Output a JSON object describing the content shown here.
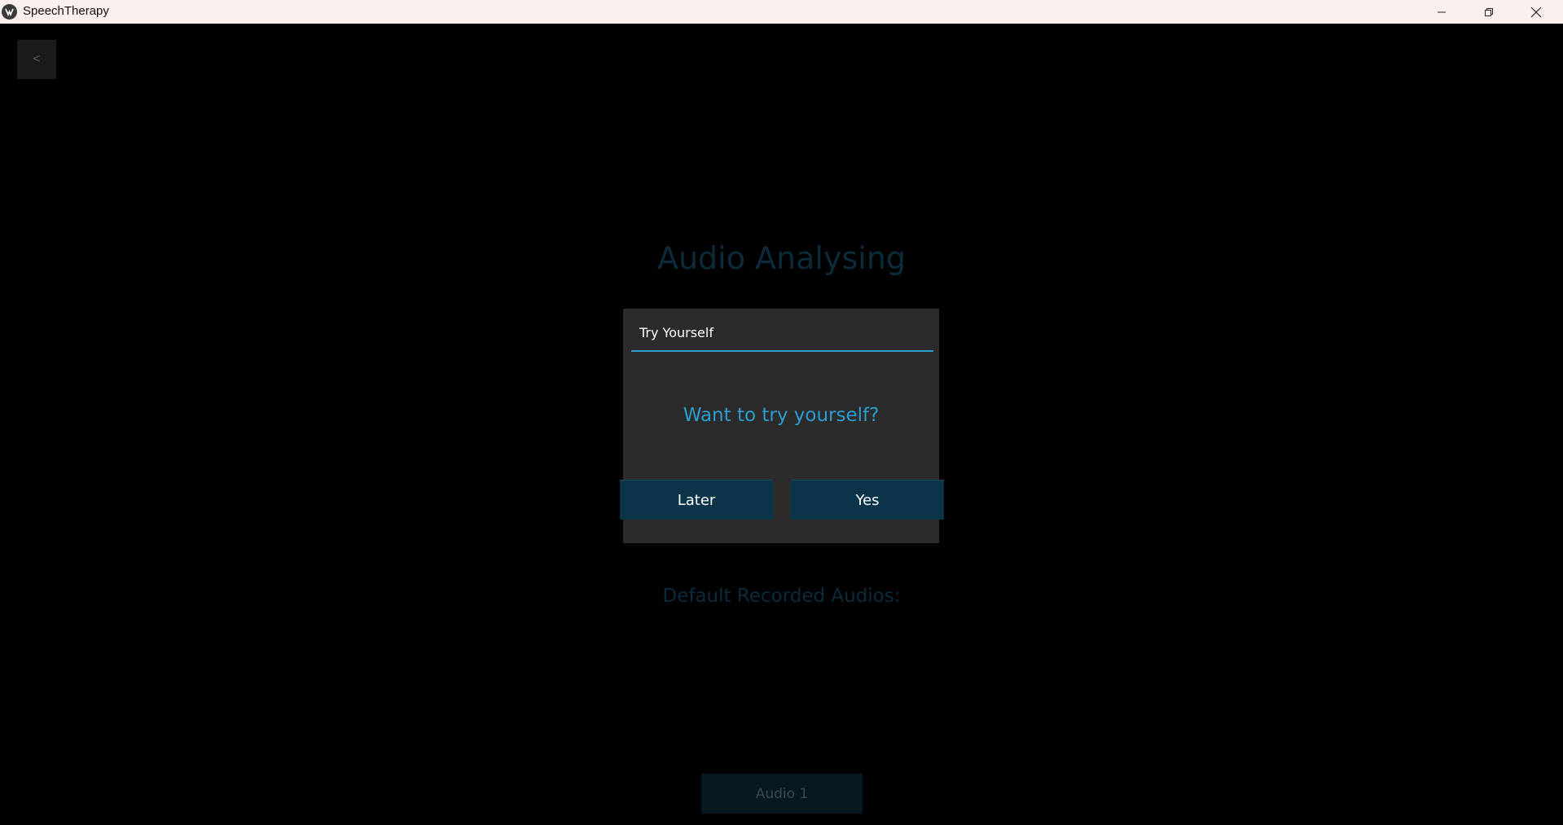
{
  "window": {
    "title": "SpeechTherapy",
    "icon": "app-logo-icon",
    "controls": [
      "minimize-icon",
      "restore-icon",
      "close-icon"
    ]
  },
  "screen": {
    "back_label": "<",
    "title": "Audio Analysing",
    "section_label": "Default Recorded Audios:",
    "audio_items": [
      {
        "label": "Audio 1"
      }
    ]
  },
  "dialog": {
    "title": "Try Yourself",
    "message": "Want to try yourself?",
    "later_label": "Later",
    "yes_label": "Yes"
  },
  "colors": {
    "background": "#000000",
    "dialog_bg": "#2b2b2b",
    "accent": "#2b9dd1",
    "button_bg": "#0a3447",
    "dimmed_text": "#0c2a3a",
    "titlebar_bg": "#faf0ee"
  }
}
